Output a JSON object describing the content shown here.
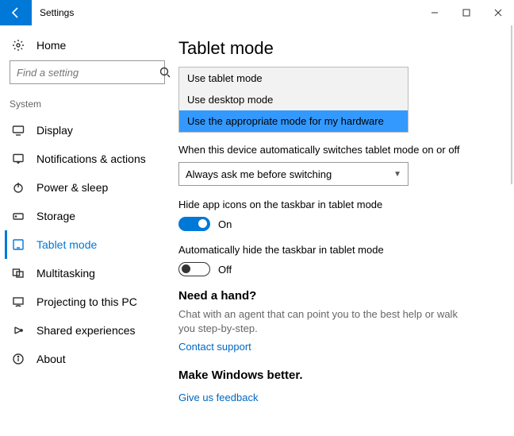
{
  "window": {
    "title": "Settings"
  },
  "sidebar": {
    "home_label": "Home",
    "search_placeholder": "Find a setting",
    "group_label": "System",
    "items": [
      {
        "label": "Display"
      },
      {
        "label": "Notifications & actions"
      },
      {
        "label": "Power & sleep"
      },
      {
        "label": "Storage"
      },
      {
        "label": "Tablet mode"
      },
      {
        "label": "Multitasking"
      },
      {
        "label": "Projecting to this PC"
      },
      {
        "label": "Shared experiences"
      },
      {
        "label": "About"
      }
    ]
  },
  "main": {
    "heading": "Tablet mode",
    "mode_dropdown": {
      "options": [
        "Use tablet mode",
        "Use desktop mode",
        "Use the appropriate mode for my hardware"
      ]
    },
    "auto_switch": {
      "label": "When this device automatically switches tablet mode on or off",
      "value": "Always ask me before switching"
    },
    "hide_icons": {
      "label": "Hide app icons on the taskbar in tablet mode",
      "state": "On"
    },
    "hide_taskbar": {
      "label": "Automatically hide the taskbar in tablet mode",
      "state": "Off"
    },
    "help": {
      "heading": "Need a hand?",
      "text": "Chat with an agent that can point you to the best help or walk you step-by-step.",
      "link": "Contact support"
    },
    "feedback": {
      "heading": "Make Windows better.",
      "link": "Give us feedback"
    }
  }
}
